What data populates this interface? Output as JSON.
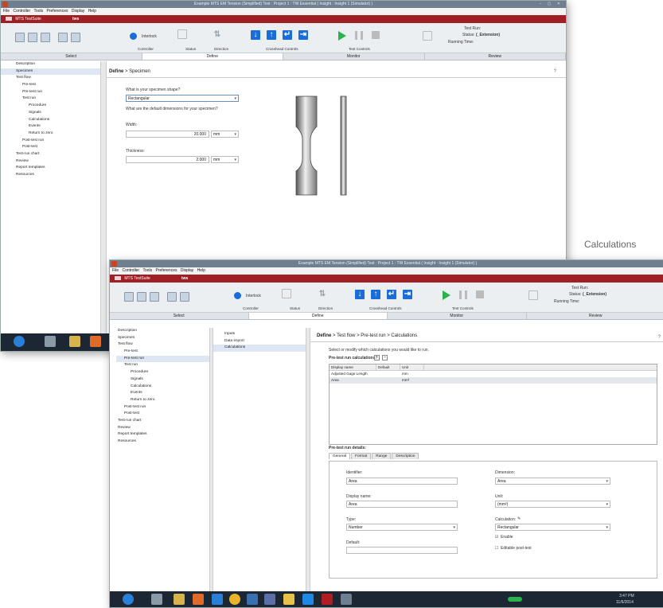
{
  "caption": "Calculations",
  "back": {
    "title": "Example MTS EM Tension (Simplified) Test : Project 1 : TW Essential ( Insight : Insight 1 (Simulator) )",
    "menu": [
      "File",
      "Controller",
      "Tools",
      "Preferences",
      "Display",
      "Help"
    ],
    "brand": "MTS TestSuite",
    "brand_tag": "tws",
    "ribbon": {
      "interlock": "Interlock",
      "controller": "Controller",
      "status": "Status",
      "direction": "Direction",
      "crosshead": "Crosshead Controls",
      "test_controls": "Test Controls",
      "test_run": "Test Run:",
      "status_label": "Status:",
      "status_value": "(_Extension)",
      "running_time": "Running Time:"
    },
    "tabs": [
      "Select",
      "Define",
      "Monitor",
      "Review"
    ],
    "tree": [
      "Description",
      "Specimen",
      "Test flow",
      "Pre-test",
      "Pre-test run",
      "Test run",
      "Procedure",
      "Signals",
      "Calculations",
      "Events",
      "Return to zero",
      "Post-test run",
      "Post-test",
      "Test-run chart",
      "Review",
      "Report templates",
      "Resources"
    ],
    "breadcrumb_root": "Define",
    "breadcrumb_rest": " > Specimen",
    "help": "?",
    "q_shape": "What is your specimen shape?",
    "shape": "Rectangular",
    "q_dims": "What are the default dimensions for your specimen?",
    "width_label": "Width:",
    "width_value": "20.000",
    "width_unit": "mm",
    "thickness_label": "Thickness:",
    "thickness_value": "2.000",
    "thickness_unit": "mm"
  },
  "front": {
    "title": "Example MTS EM Tension (Simplified) Test : Project 1 : TW Essential ( Insight : Insight 1 (Simulator) )",
    "menu": [
      "File",
      "Controller",
      "Tools",
      "Preferences",
      "Display",
      "Help"
    ],
    "brand": "MTS TestSuite",
    "brand_tag": "tws",
    "ribbon": {
      "interlock": "Interlock",
      "controller": "Controller",
      "status": "Status",
      "direction": "Direction",
      "crosshead": "Crosshead Controls",
      "test_controls": "Test Controls",
      "test_run": "Test Run:",
      "status_label": "Status:",
      "status_value": "(_Extension)",
      "running_time": "Running Time:"
    },
    "tabs": [
      "Select",
      "Define",
      "Monitor",
      "Review"
    ],
    "tree": [
      "Description",
      "Specimen",
      "Test flow",
      "Pre-test",
      "Pre-test run",
      "Test run",
      "Procedure",
      "Signals",
      "Calculations",
      "Events",
      "Return to zero",
      "Post-test run",
      "Post-test",
      "Test-run chart",
      "Review",
      "Report templates",
      "Resources"
    ],
    "subnav": [
      "Inputs",
      "Data import",
      "Calculations"
    ],
    "breadcrumb_root": "Define",
    "breadcrumb_rest": " > Test flow > Pre-test run > Calculations",
    "help": "?",
    "instruction": "Select or modify which calculations you would like to run.",
    "calc_header": "Pre-test run calculations:",
    "columns": [
      "Display name",
      "Default",
      "Unit"
    ],
    "rows": [
      {
        "name": "Adjusted Gage Length",
        "unit": "mm"
      },
      {
        "name": "Area",
        "unit": "mm²"
      }
    ],
    "details_header": "Pre-test run details:",
    "detail_tabs": [
      "General",
      "Format",
      "Range",
      "Description"
    ],
    "identifier_label": "Identifier:",
    "identifier": "Area",
    "display_label": "Display name:",
    "display_name": "Area",
    "type_label": "Type:",
    "type": "Number",
    "default_label": "Default:",
    "dimension_label": "Dimension:",
    "dimension": "Area",
    "unit_label": "Unit:",
    "unit": "(mm²)",
    "calc_label": "Calculation:",
    "calculation": "Rectangular",
    "enable": "Enable",
    "editable": "Editable post-test",
    "clock_time": "3:47 PM",
    "clock_date": "11/6/2014"
  }
}
